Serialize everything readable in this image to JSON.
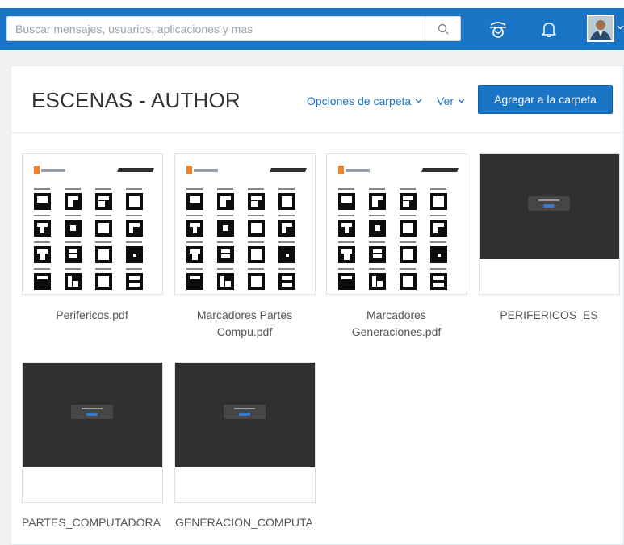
{
  "search": {
    "placeholder": "Buscar mensajes, usuarios, aplicaciones y mas"
  },
  "icons": {
    "search": "search-icon",
    "apps": "hand-icon",
    "notifications": "bell-icon",
    "avatar": "user-avatar"
  },
  "colors": {
    "brand": "#1a75c6",
    "background": "#f1f1f1",
    "dark_preview": "#303030"
  },
  "folder": {
    "title": "ESCENAS - AUTHOR",
    "options_label": "Opciones de carpeta",
    "view_label": "Ver",
    "add_label": "Agregar a la carpeta"
  },
  "files": [
    {
      "name": "Perifericos.pdf",
      "preview": "pdf"
    },
    {
      "name": "Marcadores Partes Compu.pdf",
      "preview": "pdf"
    },
    {
      "name": "Marcadores Generaciones.pdf",
      "preview": "pdf"
    },
    {
      "name": "PERIFERICOS_ES",
      "preview": "no-preview"
    },
    {
      "name": "PARTES_COMPUTADORA",
      "preview": "no-preview"
    },
    {
      "name": "GENERACION_COMPUTADORA",
      "preview": "no-preview"
    }
  ]
}
